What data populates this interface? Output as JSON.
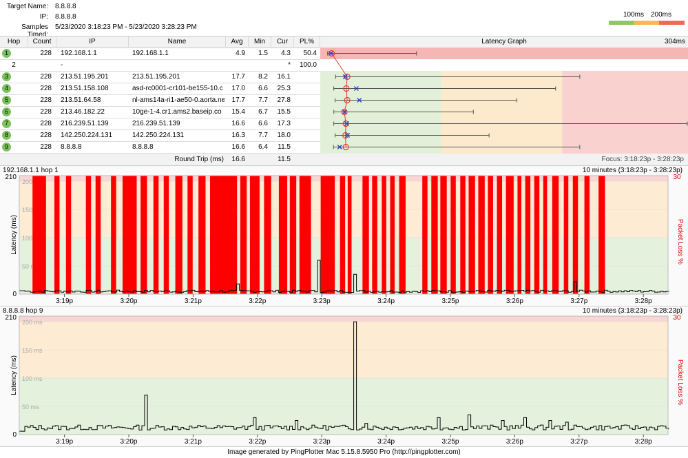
{
  "header": {
    "target_label": "Target Name:",
    "target_value": "8.8.8.8",
    "ip_label": "IP:",
    "ip_value": "8.8.8.8",
    "samples_label": "Samples Timed:",
    "samples_value": "5/23/2020 3:18:23 PM - 5/23/2020 3:28:23 PM",
    "scale_100": "100ms",
    "scale_200": "200ms",
    "scale_colors": [
      "#8dc76b",
      "#f7b955",
      "#ef6a5a"
    ]
  },
  "table": {
    "columns": [
      "Hop",
      "Count",
      "IP",
      "Name",
      "Avg",
      "Min",
      "Cur",
      "PL%",
      "Latency Graph"
    ],
    "graph_max": "304ms",
    "rows": [
      {
        "hop": "1",
        "count": "228",
        "ip": "192.168.1.1",
        "name": "192.168.1.1",
        "avg": "4.9",
        "min": "1.5",
        "cur": "4.3",
        "pl": "50.4",
        "badge": true,
        "lat_min": 1.5,
        "lat_avg": 4.9,
        "lat_max": 75,
        "lat_cur": 4.3
      },
      {
        "hop": "2",
        "count": "",
        "ip": "-",
        "name": "",
        "avg": "",
        "min": "",
        "cur": "*",
        "pl": "100.0",
        "badge": false
      },
      {
        "hop": "3",
        "count": "228",
        "ip": "213.51.195.201",
        "name": "213.51.195.201",
        "avg": "17.7",
        "min": "8.2",
        "cur": "16.1",
        "badge": true,
        "pl": "",
        "lat_min": 8.2,
        "lat_avg": 17.7,
        "lat_max": 210,
        "lat_cur": 16.1
      },
      {
        "hop": "4",
        "count": "228",
        "ip": "213.51.158.108",
        "name": "asd-rc0001-cr101-be155-10.c",
        "avg": "17.0",
        "min": "6.6",
        "cur": "25.3",
        "pl": "",
        "badge": true,
        "lat_min": 6.6,
        "lat_avg": 17.0,
        "lat_max": 190,
        "lat_cur": 25.3
      },
      {
        "hop": "5",
        "count": "228",
        "ip": "213.51.64.58",
        "name": "nl-ams14a-ri1-ae50-0.aorta.ne",
        "avg": "17.7",
        "min": "7.7",
        "cur": "27.8",
        "pl": "",
        "badge": true,
        "lat_min": 7.7,
        "lat_avg": 17.7,
        "lat_max": 158,
        "lat_cur": 27.8
      },
      {
        "hop": "6",
        "count": "228",
        "ip": "213.46.182.22",
        "name": "10ge-1-4.cr1.ams2.baseip.co",
        "avg": "15.4",
        "min": "6.7",
        "cur": "15.5",
        "pl": "",
        "badge": true,
        "lat_min": 6.7,
        "lat_avg": 15.4,
        "lat_max": 122,
        "lat_cur": 15.5
      },
      {
        "hop": "7",
        "count": "228",
        "ip": "216.239.51.139",
        "name": "216.239.51.139",
        "avg": "16.6",
        "min": "6.6",
        "cur": "17.3",
        "pl": "",
        "badge": true,
        "lat_min": 6.6,
        "lat_avg": 16.6,
        "lat_max": 304,
        "lat_cur": 17.3
      },
      {
        "hop": "8",
        "count": "228",
        "ip": "142.250.224.131",
        "name": "142.250.224.131",
        "avg": "16.3",
        "min": "7.7",
        "cur": "18.0",
        "pl": "",
        "badge": true,
        "lat_min": 7.7,
        "lat_avg": 16.3,
        "lat_max": 135,
        "lat_cur": 18.0
      },
      {
        "hop": "9",
        "count": "228",
        "ip": "8.8.8.8",
        "name": "8.8.8.8",
        "avg": "16.6",
        "min": "6.4",
        "cur": "11.5",
        "pl": "",
        "badge": true,
        "lat_min": 6.4,
        "lat_avg": 16.6,
        "lat_max": 210,
        "lat_cur": 11.5
      }
    ],
    "round_trip_label": "Round Trip (ms)",
    "round_trip_avg": "16.6",
    "round_trip_cur": "11.5",
    "focus": "Focus: 3:18:23p - 3:28:23p"
  },
  "chart1": {
    "title": "192.168.1.1 hop 1",
    "range": "10 minutes (3:18:23p - 3:28:23p)",
    "ymax_label": "210",
    "ymin_label": "0",
    "loss_max_label": "30",
    "ylabel": "Latency (ms)",
    "right_label": "Packet Loss %",
    "bands": [
      "200 ms",
      "150 ms",
      "100 ms",
      "50 ms"
    ]
  },
  "chart2": {
    "title": "8.8.8.8 hop 9",
    "range": "10 minutes (3:18:23p - 3:28:23p)",
    "ymax_label": "210",
    "ymin_label": "0",
    "loss_max_label": "30",
    "ylabel": "Latency (ms)",
    "right_label": "Packet Loss %",
    "bands": [
      "200 ms",
      "150 ms",
      "100 ms",
      "50 ms"
    ]
  },
  "chart_data": [
    {
      "type": "line",
      "series_name": "192.168.1.1 hop 1",
      "ylim": [
        0,
        210
      ],
      "x_ticks": [
        "3:19p",
        "3:20p",
        "3:21p",
        "3:22p",
        "3:23p",
        "3:24p",
        "3:25p",
        "3:26p",
        "3:27p",
        "3:28p"
      ],
      "spikes": [
        {
          "minute": 3.3,
          "ms": 18
        },
        {
          "minute": 4.55,
          "ms": 60
        },
        {
          "minute": 5.1,
          "ms": 35
        },
        {
          "minute": 8.55,
          "ms": 22
        }
      ],
      "loss_segments": [
        [
          0.12,
          0.33
        ],
        [
          0.46,
          0.54
        ],
        [
          0.64,
          0.72
        ],
        [
          0.95,
          1.03
        ],
        [
          1.1,
          1.18
        ],
        [
          1.34,
          1.42
        ],
        [
          1.52,
          1.74
        ],
        [
          1.8,
          1.9
        ],
        [
          2.0,
          2.08
        ],
        [
          2.16,
          2.24
        ],
        [
          2.34,
          2.45
        ],
        [
          2.53,
          2.61
        ],
        [
          2.7,
          2.81
        ],
        [
          2.88,
          3.3
        ],
        [
          3.35,
          3.45
        ],
        [
          3.5,
          3.65
        ],
        [
          3.72,
          3.83
        ],
        [
          3.95,
          4.08
        ],
        [
          4.12,
          4.22
        ],
        [
          4.27,
          4.45
        ],
        [
          4.6,
          4.82
        ],
        [
          4.9,
          4.98
        ],
        [
          5.02,
          5.08
        ],
        [
          5.25,
          5.35
        ],
        [
          5.4,
          5.48
        ],
        [
          5.55,
          5.62
        ],
        [
          5.68,
          5.75
        ],
        [
          5.82,
          5.92
        ],
        [
          6.18,
          6.26
        ],
        [
          6.32,
          6.42
        ],
        [
          6.46,
          6.56
        ],
        [
          6.62,
          6.7
        ],
        [
          6.77,
          6.85
        ],
        [
          6.9,
          7.0
        ],
        [
          7.05,
          7.15
        ],
        [
          7.2,
          7.28
        ],
        [
          7.34,
          7.42
        ],
        [
          7.48,
          7.6
        ],
        [
          7.66,
          7.72
        ],
        [
          7.78,
          7.86
        ],
        [
          7.92,
          8.0
        ],
        [
          8.06,
          8.12
        ],
        [
          8.2,
          8.3
        ],
        [
          8.38,
          8.45
        ],
        [
          8.52,
          8.6
        ],
        [
          8.7,
          8.78
        ],
        [
          8.92,
          9.02
        ]
      ]
    },
    {
      "type": "line",
      "series_name": "8.8.8.8 hop 9",
      "ylim": [
        0,
        210
      ],
      "x_ticks": [
        "3:19p",
        "3:20p",
        "3:21p",
        "3:22p",
        "3:23p",
        "3:24p",
        "3:25p",
        "3:26p",
        "3:27p",
        "3:28p"
      ],
      "spikes": [
        {
          "minute": 1.85,
          "ms": 70
        },
        {
          "minute": 3.55,
          "ms": 30
        },
        {
          "minute": 4.2,
          "ms": 25
        },
        {
          "minute": 5.1,
          "ms": 200
        },
        {
          "minute": 5.3,
          "ms": 20
        },
        {
          "minute": 6.4,
          "ms": 30
        },
        {
          "minute": 6.9,
          "ms": 35
        },
        {
          "minute": 7.4,
          "ms": 25
        },
        {
          "minute": 7.75,
          "ms": 30
        },
        {
          "minute": 8.15,
          "ms": 25
        },
        {
          "minute": 8.4,
          "ms": 22
        }
      ]
    }
  ],
  "footer": "Image generated by PingPlotter Mac 5.15.8.5950 Pro (http://pingplotter.com)"
}
